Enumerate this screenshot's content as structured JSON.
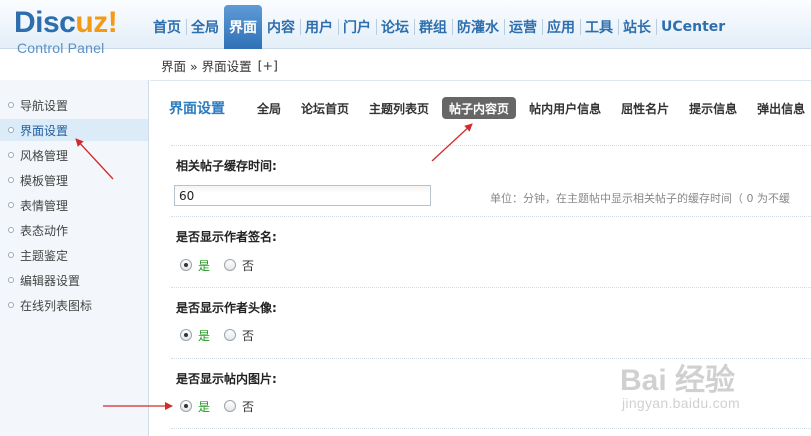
{
  "header": {
    "logo_main": "Discuz!",
    "logo_sub": "Control Panel",
    "nav": [
      "首页",
      "全局",
      "界面",
      "内容",
      "用户",
      "门户",
      "论坛",
      "群组",
      "防灌水",
      "运营",
      "应用",
      "工具",
      "站长",
      "UCenter"
    ],
    "active_nav": "界面"
  },
  "breadcrumb": {
    "path": "界面 » 界面设置",
    "add": "[+]"
  },
  "sidebar": {
    "items": [
      "导航设置",
      "界面设置",
      "风格管理",
      "模板管理",
      "表情管理",
      "表态动作",
      "主题鉴定",
      "编辑器设置",
      "在线列表图标"
    ],
    "active": "界面设置"
  },
  "main": {
    "title": "界面设置",
    "tabs": [
      "全局",
      "论坛首页",
      "主题列表页",
      "帖子内容页",
      "帖内用户信息",
      "屈性名片",
      "提示信息",
      "弹出信息"
    ],
    "active_tab": "帖子内容页",
    "fields": [
      {
        "label": "相关帖子缓存时间:",
        "value": "60",
        "hint": "单位：分钟，在主题帖中显示相关帖子的缓存时间（ 0 为不缓"
      },
      {
        "label": "是否显示作者签名:",
        "yes": "是",
        "no": "否",
        "selected": "yes"
      },
      {
        "label": "是否显示作者头像:",
        "yes": "是",
        "no": "否",
        "selected": "yes"
      },
      {
        "label": "是否显示帖内图片:",
        "yes": "是",
        "no": "否",
        "selected": "yes"
      }
    ]
  },
  "watermark": {
    "brand": "Bai 经验",
    "url": "jingyan.baidu.com"
  },
  "colors": {
    "nav_blue": "#2d6fae",
    "logo_orange": "#f49a16",
    "title_blue": "#2d7cbf",
    "yes_green": "#1c9a1c",
    "arrow_red": "#d42a2a"
  }
}
